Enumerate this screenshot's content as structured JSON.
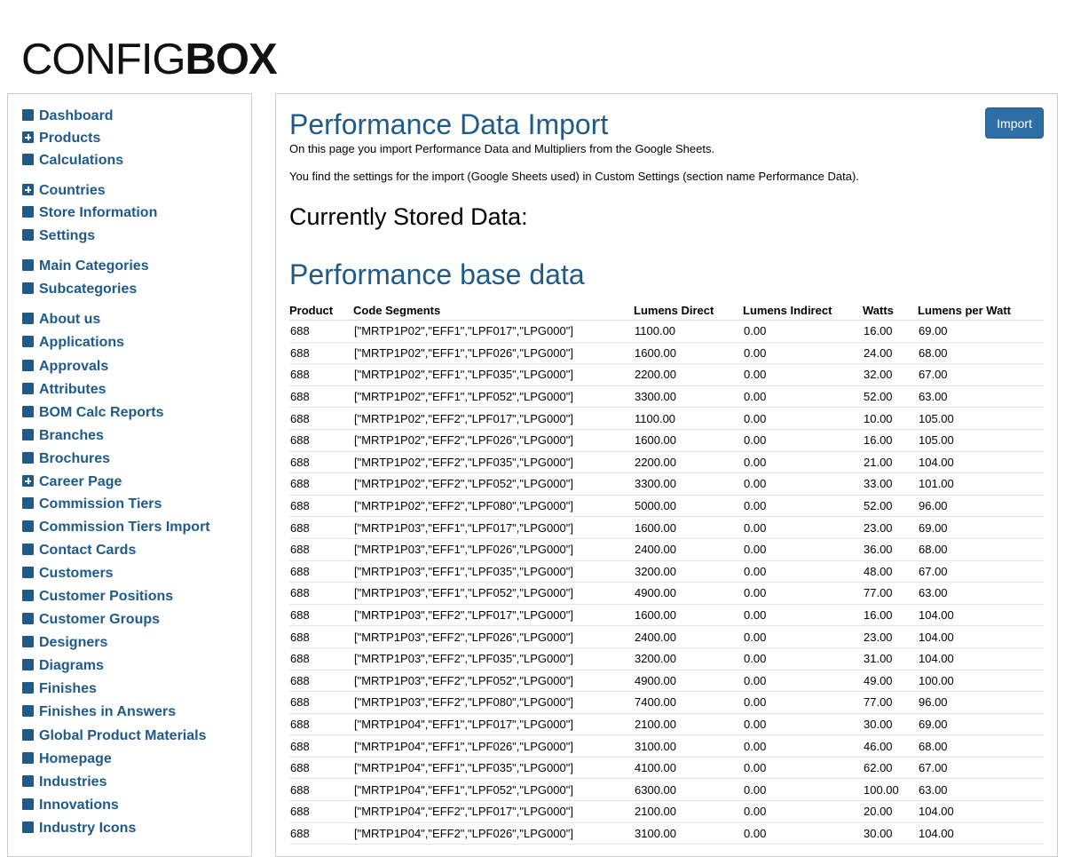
{
  "logo": {
    "part1": "CONFIG",
    "part2": "BOX"
  },
  "sidebar": {
    "items": [
      {
        "label": "Dashboard",
        "icon": "square-icon"
      },
      {
        "label": "Products",
        "icon": "plus-square-icon"
      },
      {
        "label": "Calculations",
        "icon": "square-icon"
      },
      {
        "label": "Countries",
        "icon": "plus-square-icon"
      },
      {
        "label": "Store Information",
        "icon": "square-icon"
      },
      {
        "label": "Settings",
        "icon": "square-icon"
      },
      {
        "label": "Main Categories",
        "icon": "square-icon"
      },
      {
        "label": "Subcategories",
        "icon": "square-icon"
      },
      {
        "label": "About us",
        "icon": "square-icon"
      },
      {
        "label": "Applications",
        "icon": "square-icon"
      },
      {
        "label": "Approvals",
        "icon": "square-icon"
      },
      {
        "label": "Attributes",
        "icon": "square-icon"
      },
      {
        "label": "BOM Calc Reports",
        "icon": "square-icon"
      },
      {
        "label": "Branches",
        "icon": "square-icon"
      },
      {
        "label": "Brochures",
        "icon": "square-icon"
      },
      {
        "label": "Career Page",
        "icon": "plus-square-icon"
      },
      {
        "label": "Commission Tiers",
        "icon": "square-icon"
      },
      {
        "label": "Commission Tiers Import",
        "icon": "square-icon"
      },
      {
        "label": "Contact Cards",
        "icon": "square-icon"
      },
      {
        "label": "Customers",
        "icon": "square-icon"
      },
      {
        "label": "Customer Positions",
        "icon": "square-icon"
      },
      {
        "label": "Customer Groups",
        "icon": "square-icon"
      },
      {
        "label": "Designers",
        "icon": "square-icon"
      },
      {
        "label": "Diagrams",
        "icon": "square-icon"
      },
      {
        "label": "Finishes",
        "icon": "square-icon"
      },
      {
        "label": "Finishes in Answers",
        "icon": "square-icon"
      },
      {
        "label": "Global Product Materials",
        "icon": "square-icon"
      },
      {
        "label": "Homepage",
        "icon": "square-icon"
      },
      {
        "label": "Industries",
        "icon": "square-icon"
      },
      {
        "label": "Innovations",
        "icon": "square-icon"
      },
      {
        "label": "Industry Icons",
        "icon": "square-icon"
      }
    ]
  },
  "main": {
    "title": "Performance Data Import",
    "import_label": "Import",
    "intro1": "On this page you import Performance Data and Multipliers from the Google Sheets.",
    "intro2": "You find the settings for the import (Google Sheets used) in Custom Settings (section name Performance Data).",
    "stored_heading": "Currently Stored Data:",
    "base_heading": "Performance base data",
    "table": {
      "headers": [
        "Product",
        "Code Segments",
        "Lumens Direct",
        "Lumens Indirect",
        "Watts",
        "Lumens per Watt"
      ],
      "rows": [
        [
          "688",
          "[\"MRTP1P02\",\"EFF1\",\"LPF017\",\"LPG000\"]",
          "1100.00",
          "0.00",
          "16.00",
          "69.00"
        ],
        [
          "688",
          "[\"MRTP1P02\",\"EFF1\",\"LPF026\",\"LPG000\"]",
          "1600.00",
          "0.00",
          "24.00",
          "68.00"
        ],
        [
          "688",
          "[\"MRTP1P02\",\"EFF1\",\"LPF035\",\"LPG000\"]",
          "2200.00",
          "0.00",
          "32.00",
          "67.00"
        ],
        [
          "688",
          "[\"MRTP1P02\",\"EFF1\",\"LPF052\",\"LPG000\"]",
          "3300.00",
          "0.00",
          "52.00",
          "63.00"
        ],
        [
          "688",
          "[\"MRTP1P02\",\"EFF2\",\"LPF017\",\"LPG000\"]",
          "1100.00",
          "0.00",
          "10.00",
          "105.00"
        ],
        [
          "688",
          "[\"MRTP1P02\",\"EFF2\",\"LPF026\",\"LPG000\"]",
          "1600.00",
          "0.00",
          "16.00",
          "105.00"
        ],
        [
          "688",
          "[\"MRTP1P02\",\"EFF2\",\"LPF035\",\"LPG000\"]",
          "2200.00",
          "0.00",
          "21.00",
          "104.00"
        ],
        [
          "688",
          "[\"MRTP1P02\",\"EFF2\",\"LPF052\",\"LPG000\"]",
          "3300.00",
          "0.00",
          "33.00",
          "101.00"
        ],
        [
          "688",
          "[\"MRTP1P02\",\"EFF2\",\"LPF080\",\"LPG000\"]",
          "5000.00",
          "0.00",
          "52.00",
          "96.00"
        ],
        [
          "688",
          "[\"MRTP1P03\",\"EFF1\",\"LPF017\",\"LPG000\"]",
          "1600.00",
          "0.00",
          "23.00",
          "69.00"
        ],
        [
          "688",
          "[\"MRTP1P03\",\"EFF1\",\"LPF026\",\"LPG000\"]",
          "2400.00",
          "0.00",
          "36.00",
          "68.00"
        ],
        [
          "688",
          "[\"MRTP1P03\",\"EFF1\",\"LPF035\",\"LPG000\"]",
          "3200.00",
          "0.00",
          "48.00",
          "67.00"
        ],
        [
          "688",
          "[\"MRTP1P03\",\"EFF1\",\"LPF052\",\"LPG000\"]",
          "4900.00",
          "0.00",
          "77.00",
          "63.00"
        ],
        [
          "688",
          "[\"MRTP1P03\",\"EFF2\",\"LPF017\",\"LPG000\"]",
          "1600.00",
          "0.00",
          "16.00",
          "104.00"
        ],
        [
          "688",
          "[\"MRTP1P03\",\"EFF2\",\"LPF026\",\"LPG000\"]",
          "2400.00",
          "0.00",
          "23.00",
          "104.00"
        ],
        [
          "688",
          "[\"MRTP1P03\",\"EFF2\",\"LPF035\",\"LPG000\"]",
          "3200.00",
          "0.00",
          "31.00",
          "104.00"
        ],
        [
          "688",
          "[\"MRTP1P03\",\"EFF2\",\"LPF052\",\"LPG000\"]",
          "4900.00",
          "0.00",
          "49.00",
          "100.00"
        ],
        [
          "688",
          "[\"MRTP1P03\",\"EFF2\",\"LPF080\",\"LPG000\"]",
          "7400.00",
          "0.00",
          "77.00",
          "96.00"
        ],
        [
          "688",
          "[\"MRTP1P04\",\"EFF1\",\"LPF017\",\"LPG000\"]",
          "2100.00",
          "0.00",
          "30.00",
          "69.00"
        ],
        [
          "688",
          "[\"MRTP1P04\",\"EFF1\",\"LPF026\",\"LPG000\"]",
          "3100.00",
          "0.00",
          "46.00",
          "68.00"
        ],
        [
          "688",
          "[\"MRTP1P04\",\"EFF1\",\"LPF035\",\"LPG000\"]",
          "4100.00",
          "0.00",
          "62.00",
          "67.00"
        ],
        [
          "688",
          "[\"MRTP1P04\",\"EFF1\",\"LPF052\",\"LPG000\"]",
          "6300.00",
          "0.00",
          "100.00",
          "63.00"
        ],
        [
          "688",
          "[\"MRTP1P04\",\"EFF2\",\"LPF017\",\"LPG000\"]",
          "2100.00",
          "0.00",
          "20.00",
          "104.00"
        ],
        [
          "688",
          "[\"MRTP1P04\",\"EFF2\",\"LPF026\",\"LPG000\"]",
          "3100.00",
          "0.00",
          "30.00",
          "104.00"
        ]
      ]
    }
  },
  "colors": {
    "brand_blue": "#1e5a8a",
    "button_blue": "#2f6fa8"
  }
}
